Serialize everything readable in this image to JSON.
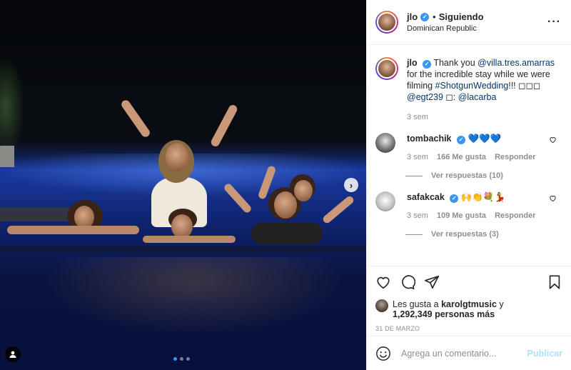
{
  "post": {
    "photo_alt": "",
    "carousel_dots": 3,
    "active_dot": 0
  },
  "header": {
    "username": "jlo",
    "separator": "•",
    "follow_label": "Siguiendo",
    "location": "Dominican Republic",
    "more_icon": "more-horizontal-icon"
  },
  "caption": {
    "username": "jlo",
    "text_parts": [
      "Thank you ",
      "@villa.tres.amarras",
      " for the incredible stay while we were filming ",
      "#ShotgunWedding",
      "!!! ◻◻◻ ",
      "@egt239",
      " ◻: ",
      "@lacarba"
    ],
    "time": "3 sem"
  },
  "comments": [
    {
      "username": "tombachik",
      "text": "💙💙💙",
      "time": "3 sem",
      "likes": "166 Me gusta",
      "reply_label": "Responder",
      "view_replies": "Ver respuestas (10)"
    },
    {
      "username": "safakcak",
      "text": "🙌👏💐💃",
      "time": "3 sem",
      "likes": "109 Me gusta",
      "reply_label": "Responder",
      "view_replies": "Ver respuestas (3)"
    }
  ],
  "likes": {
    "prefix": "Les gusta a ",
    "user": "karolgtmusic",
    "middle": " y",
    "count": "1,292,349 personas más"
  },
  "date": "31 DE MARZO",
  "add_comment": {
    "placeholder": "Agrega un comentario...",
    "post_label": "Publicar"
  },
  "colors": {
    "link": "#00376b",
    "verified": "#3897f0",
    "muted": "#8e8e8e",
    "post_disabled": "#b2dffc"
  }
}
